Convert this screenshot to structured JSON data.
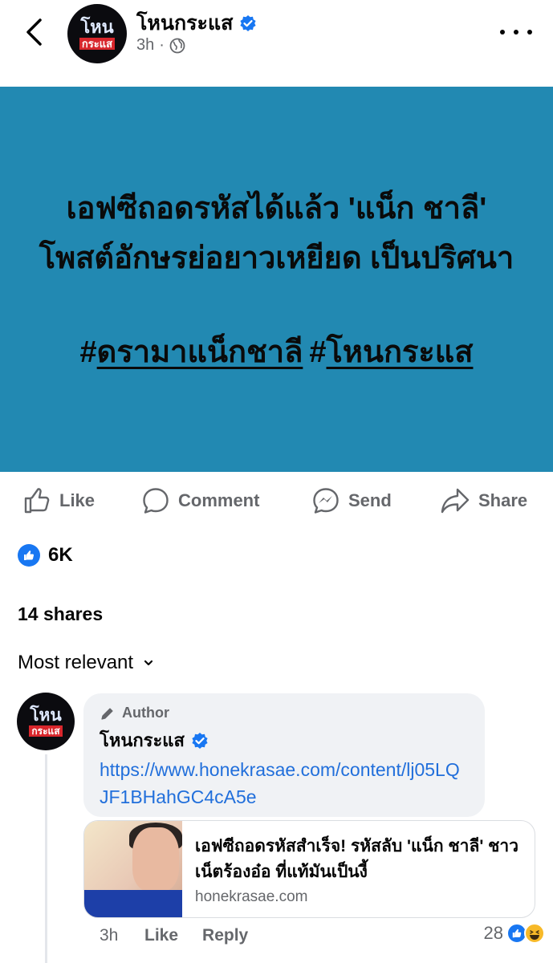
{
  "header": {
    "page_name": "โหนกระแส",
    "time": "3h",
    "visibility_icon": "globe-icon",
    "logo_top": "โหน",
    "logo_bottom": "กระแส"
  },
  "post": {
    "background": "#2289b2",
    "headline": "เอฟซีถอดรหัสได้แล้ว 'แน็ก ชาลี' โพสต์อักษรย่อยาวเหยียด เป็นปริศนา",
    "tags": [
      {
        "hash": "#",
        "text": "ดรามาแน็กชาลี"
      },
      {
        "hash": "#",
        "text": "โหนกระแส"
      }
    ]
  },
  "actions": {
    "like": "Like",
    "comment": "Comment",
    "send": "Send",
    "share": "Share"
  },
  "reactions": {
    "count": "6K",
    "shares": "14 shares"
  },
  "sort": {
    "label": "Most relevant"
  },
  "comment": {
    "badge": "Author",
    "name": "โหนกระแส",
    "link": "https://www.honekrasae.com/content/lj05LQJF1BHahGC4cA5e",
    "card_title": "เอฟซีถอดรหัสสำเร็จ! รหัสลับ 'แน็ก ชาลี' ชาวเน็ตร้องอ๋อ ที่แท้มันเป็นงี้",
    "card_domain": "honekrasae.com",
    "time": "3h",
    "like_label": "Like",
    "reply_label": "Reply",
    "reaction_count": "28"
  },
  "colors": {
    "accent": "#1877f2",
    "link": "#216fdb",
    "muted": "#65676b"
  }
}
